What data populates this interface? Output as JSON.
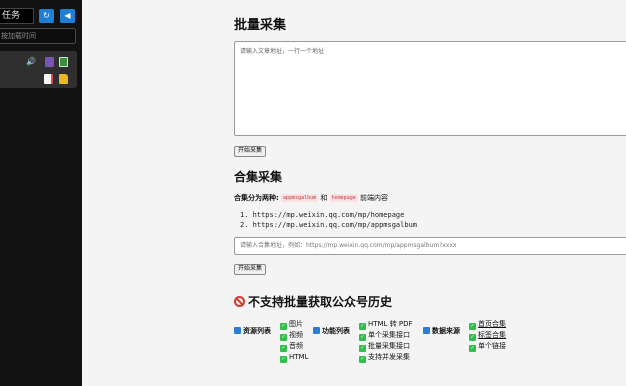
{
  "sidebar": {
    "task_label": "任务",
    "refresh_icon": "↻",
    "back_icon": "◀",
    "search_placeholder": "按加载时间",
    "file_icons": [
      "sound-icon",
      "video-icon",
      "image-icon",
      "document-icon",
      "folder-icon"
    ]
  },
  "batch": {
    "title": "批量采集",
    "textarea_placeholder": "请输入文章地址，一行一个地址",
    "start_button": "开始采集"
  },
  "album": {
    "title": "合集采集",
    "desc_label": "合集分为两种:",
    "code1": "appmsgalbum",
    "and": "和",
    "code2": "homepage",
    "desc_suffix": "前端内容",
    "urls": [
      "1. https://mp.weixin.qq.com/mp/homepage",
      "2. https://mp.weixin.qq.com/mp/appmsgalbum"
    ],
    "input_placeholder": "请输入合集地址，例如：https://mp.weixin.qq.com/mp/appmsgalbum?xxxx",
    "start_button": "开始采集"
  },
  "nosupport": {
    "title": "不支持批量获取公众号历史"
  },
  "features": {
    "resources_label": "资源列表",
    "resources": [
      "图片",
      "视频",
      "音频",
      "HTML"
    ],
    "functions_label": "功能列表",
    "functions": [
      "HTML 转 PDF",
      "单个采集接口",
      "批量采集接口",
      "支持并发采集"
    ],
    "sources_label": "数据来源",
    "sources": [
      "首页合集",
      "标签合集",
      "单个链接"
    ]
  },
  "colors": {
    "sidebar_bg": "#121212",
    "accent_blue": "#1f7fd6",
    "check_green": "#2fbf4a",
    "ban_red": "#d4392f"
  }
}
